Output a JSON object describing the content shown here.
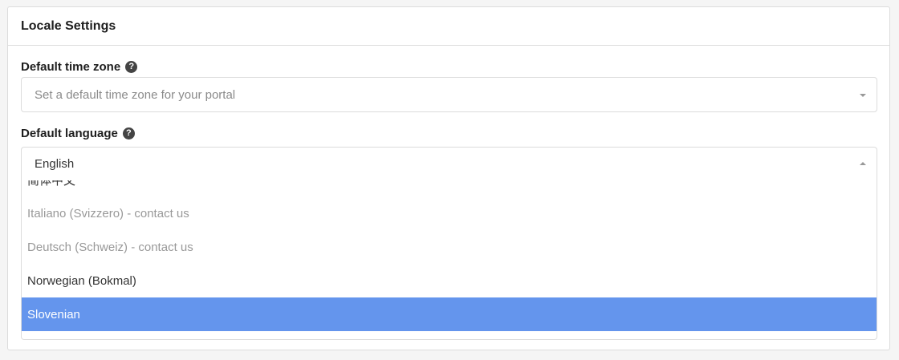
{
  "panel": {
    "title": "Locale Settings"
  },
  "timezone": {
    "label": "Default time zone",
    "placeholder": "Set a default time zone for your portal",
    "help_icon": "question-circle-icon"
  },
  "language": {
    "label": "Default language",
    "value": "English",
    "help_icon": "question-circle-icon",
    "options": [
      {
        "label": "简体中文",
        "disabled": false,
        "selected": false
      },
      {
        "label": "Italiano (Svizzero) - contact us",
        "disabled": true,
        "selected": false
      },
      {
        "label": "Deutsch (Schweiz) - contact us",
        "disabled": true,
        "selected": false
      },
      {
        "label": "Norwegian (Bokmal)",
        "disabled": false,
        "selected": false
      },
      {
        "label": "Slovenian",
        "disabled": false,
        "selected": true
      }
    ]
  },
  "colors": {
    "highlight": "#6495ed",
    "disabled_text": "#999999",
    "border": "#dcdcdc"
  }
}
